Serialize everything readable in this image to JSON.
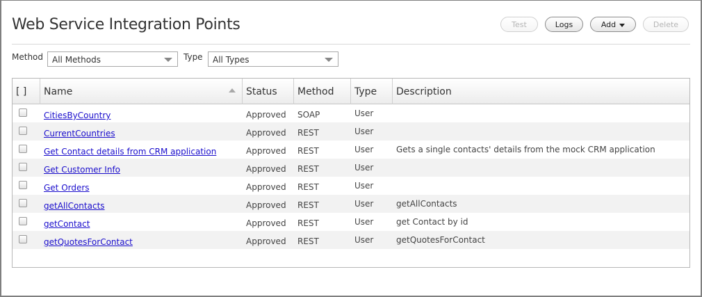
{
  "page": {
    "title": "Web Service Integration Points"
  },
  "toolbar": {
    "test_label": "Test",
    "logs_label": "Logs",
    "add_label": "Add",
    "delete_label": "Delete"
  },
  "filters": {
    "method_label": "Method",
    "method_value": "All Methods",
    "type_label": "Type",
    "type_value": "All Types"
  },
  "grid": {
    "columns": {
      "select": "[ ]",
      "name": "Name",
      "status": "Status",
      "method": "Method",
      "type": "Type",
      "description": "Description"
    },
    "rows": [
      {
        "name": "CitiesByCountry",
        "status": "Approved",
        "method": "SOAP",
        "type": "User",
        "description": ""
      },
      {
        "name": "CurrentCountries",
        "status": "Approved",
        "method": "REST",
        "type": "User",
        "description": ""
      },
      {
        "name": "Get Contact details from CRM application",
        "status": "Approved",
        "method": "REST",
        "type": "User",
        "description": "Gets a single contacts' details from the mock CRM application"
      },
      {
        "name": "Get Customer Info",
        "status": "Approved",
        "method": "REST",
        "type": "User",
        "description": ""
      },
      {
        "name": "Get Orders",
        "status": "Approved",
        "method": "REST",
        "type": "User",
        "description": ""
      },
      {
        "name": "getAllContacts",
        "status": "Approved",
        "method": "REST",
        "type": "User",
        "description": "getAllContacts"
      },
      {
        "name": "getContact",
        "status": "Approved",
        "method": "REST",
        "type": "User",
        "description": "get Contact by id"
      },
      {
        "name": "getQuotesForContact",
        "status": "Approved",
        "method": "REST",
        "type": "User",
        "description": "getQuotesForContact"
      }
    ]
  }
}
